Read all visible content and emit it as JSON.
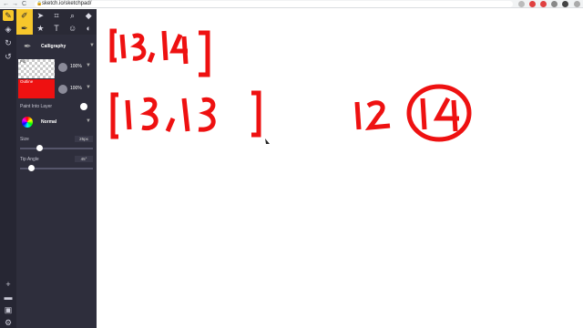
{
  "browser": {
    "url": "sketch.io/sketchpad/",
    "back": "←",
    "forward": "→",
    "reload": "C"
  },
  "panel": {
    "brush_name": "Calligraphy",
    "fill_label": "Fill",
    "fill_opacity": "100%",
    "outline_label": "Outline",
    "outline_opacity": "100%",
    "outline_color": "#ee1111",
    "paint_into_layer_label": "Paint Into Layer",
    "blend_mode": "Normal",
    "size_label": "Size",
    "size_value": "25px",
    "size_level": 0.25,
    "tip_angle_label": "Tip Angle",
    "tip_angle_value": "45°",
    "tip_angle_level": 0.13
  },
  "toolbar": {
    "tools": [
      "brush-tool",
      "select-tool",
      "crop-tool",
      "zoom-tool",
      "layers-tool",
      "pen-tool",
      "star-tool",
      "text-tool",
      "emoji-tool",
      "fill-tool"
    ]
  },
  "canvas": {
    "drawn_texts": [
      "[13,14]",
      "[13,13]",
      "12",
      "14"
    ],
    "ink_color": "#ee1111"
  }
}
